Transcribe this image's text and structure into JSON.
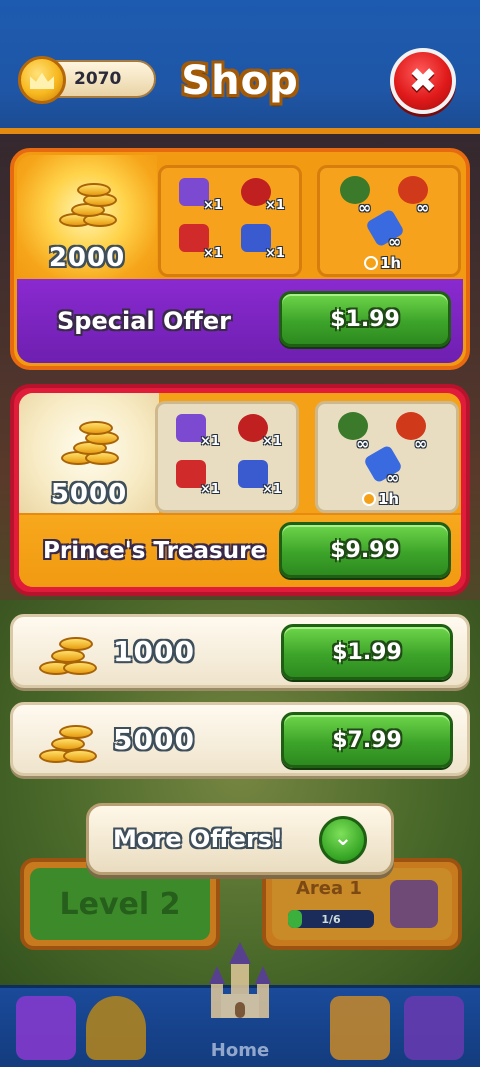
{
  "header": {
    "coins": "2070",
    "title": "Shop"
  },
  "offers": [
    {
      "name": "Special Offer",
      "coins": "2000",
      "price": "$1.99",
      "boosters": [
        "×1",
        "×1",
        "×1",
        "×1"
      ],
      "powerups": [
        "∞",
        "∞",
        "∞"
      ],
      "duration": "1h"
    },
    {
      "name": "Prince's Treasure",
      "coins": "5000",
      "price": "$9.99",
      "boosters": [
        "×1",
        "×1",
        "×1",
        "×1"
      ],
      "powerups": [
        "∞",
        "∞",
        "∞"
      ],
      "duration": "1h"
    }
  ],
  "coin_packs": [
    {
      "coins": "1000",
      "price": "$1.99"
    },
    {
      "coins": "5000",
      "price": "$7.99"
    }
  ],
  "more_offers": "More Offers!",
  "background": {
    "level": "Level 2",
    "area": "Area 1",
    "area_progress": "1/6",
    "area_progress_fraction": 0.1667
  },
  "nav": {
    "active": "Home"
  },
  "colors": {
    "topbar": "#1f56a6",
    "special_offer_bar": "#7a22c0",
    "treasure_border": "#e01c3a",
    "buy_green": "#3da42a",
    "close_red": "#e01a1a"
  }
}
